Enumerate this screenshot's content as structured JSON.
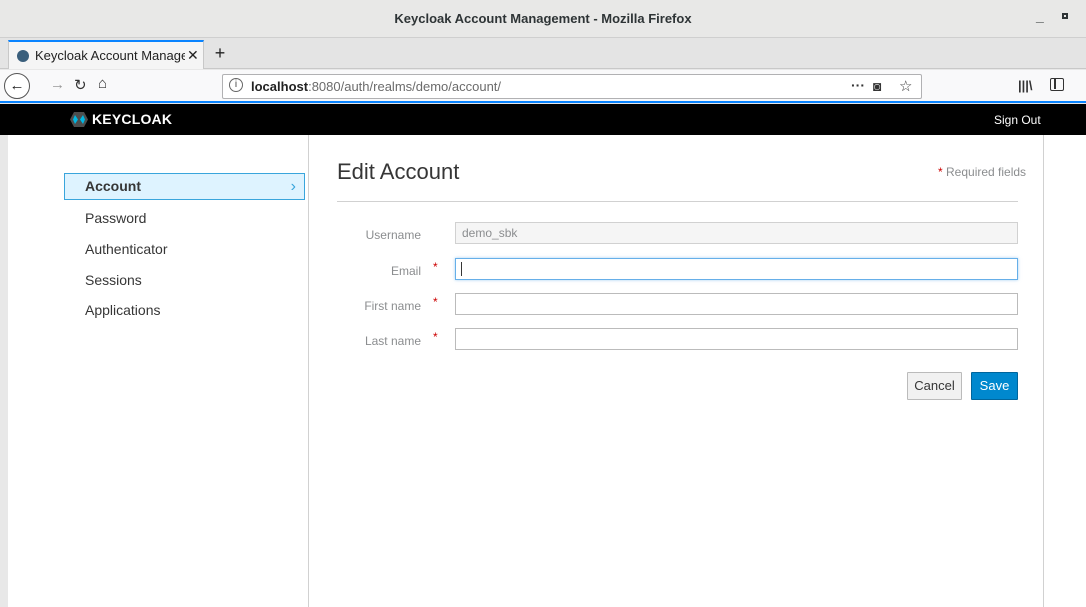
{
  "window": {
    "title": "Keycloak Account Management - Mozilla Firefox"
  },
  "tabs": [
    {
      "label": "Keycloak Account Manage"
    }
  ],
  "urlbar": {
    "host": "localhost",
    "rest": ":8080/auth/realms/demo/account/"
  },
  "header": {
    "logo_text": "KEYCLOAK",
    "sign_out": "Sign Out"
  },
  "sidebar": {
    "items": [
      {
        "label": "Account",
        "active": true
      },
      {
        "label": "Password"
      },
      {
        "label": "Authenticator"
      },
      {
        "label": "Sessions"
      },
      {
        "label": "Applications"
      }
    ]
  },
  "main": {
    "title": "Edit Account",
    "required_star": "*",
    "required_note": "Required fields",
    "fields": {
      "username": {
        "label": "Username",
        "value": "demo_sbk"
      },
      "email": {
        "label": "Email",
        "value": ""
      },
      "first_name": {
        "label": "First name",
        "value": ""
      },
      "last_name": {
        "label": "Last name",
        "value": ""
      }
    },
    "cancel_label": "Cancel",
    "save_label": "Save"
  },
  "colors": {
    "accent": "#0088ce",
    "active_bg": "#def3ff",
    "required": "#cc0000",
    "header_bg": "#000000"
  }
}
